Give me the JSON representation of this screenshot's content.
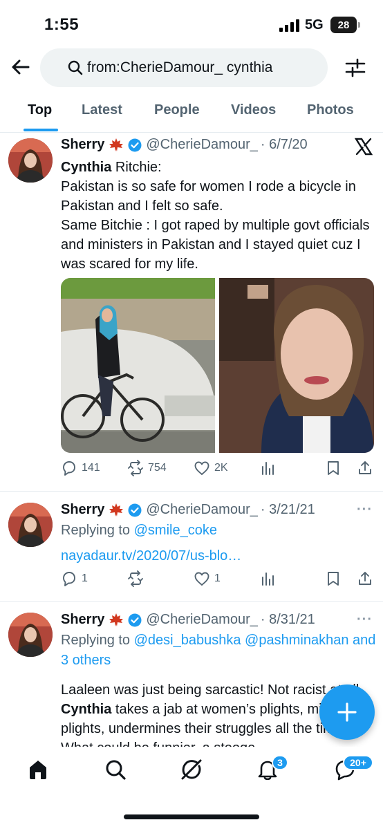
{
  "status": {
    "time": "1:55",
    "network": "5G",
    "battery": "28"
  },
  "search": {
    "query": "from:CherieDamour_ cynthia"
  },
  "tabs": [
    {
      "label": "Top"
    },
    {
      "label": "Latest"
    },
    {
      "label": "People"
    },
    {
      "label": "Videos"
    },
    {
      "label": "Photos"
    }
  ],
  "posts": [
    {
      "name": "Sherry",
      "handle": "@CherieDamour_",
      "date": "· 6/7/20",
      "text_bold": "Cynthia",
      "text_rest": " Ritchie:",
      "text_lines": [
        "Pakistan is so safe for women I rode a bicycle in Pakistan and I felt so safe.",
        "Same Bitchie : I got raped by multiple govt officials and ministers in Pakistan and I stayed quiet cuz I was scared for my life."
      ],
      "replies": "141",
      "reposts": "754",
      "likes": "2K"
    },
    {
      "name": "Sherry",
      "handle": "@CherieDamour_",
      "date": "· 3/21/21",
      "replying_prefix": "Replying to ",
      "replying_to": "@smile_coke",
      "link": "nayadaur.tv/2020/07/us-blo…",
      "replies": "1",
      "reposts": "",
      "likes": "1"
    },
    {
      "name": "Sherry",
      "handle": "@CherieDamour_",
      "date": "· 8/31/21",
      "replying_prefix": "Replying to ",
      "replying_to_1": "@desi_babushka",
      "replying_to_2": "@pashminakhan",
      "replying_others": "and 3 others",
      "text_a": "Laaleen was just being sarcastic! Not racist at all. ",
      "text_bold": "Cynthia",
      "text_b": " takes a jab at women’s plights, minorities plights, undermines their struggles all the time. What could be funnier, a stooge"
    }
  ],
  "nav": {
    "notifications_badge": "3",
    "messages_badge": "20+"
  },
  "colors": {
    "accent": "#1d9bf0",
    "text": "#0f1419",
    "muted": "#536471"
  }
}
